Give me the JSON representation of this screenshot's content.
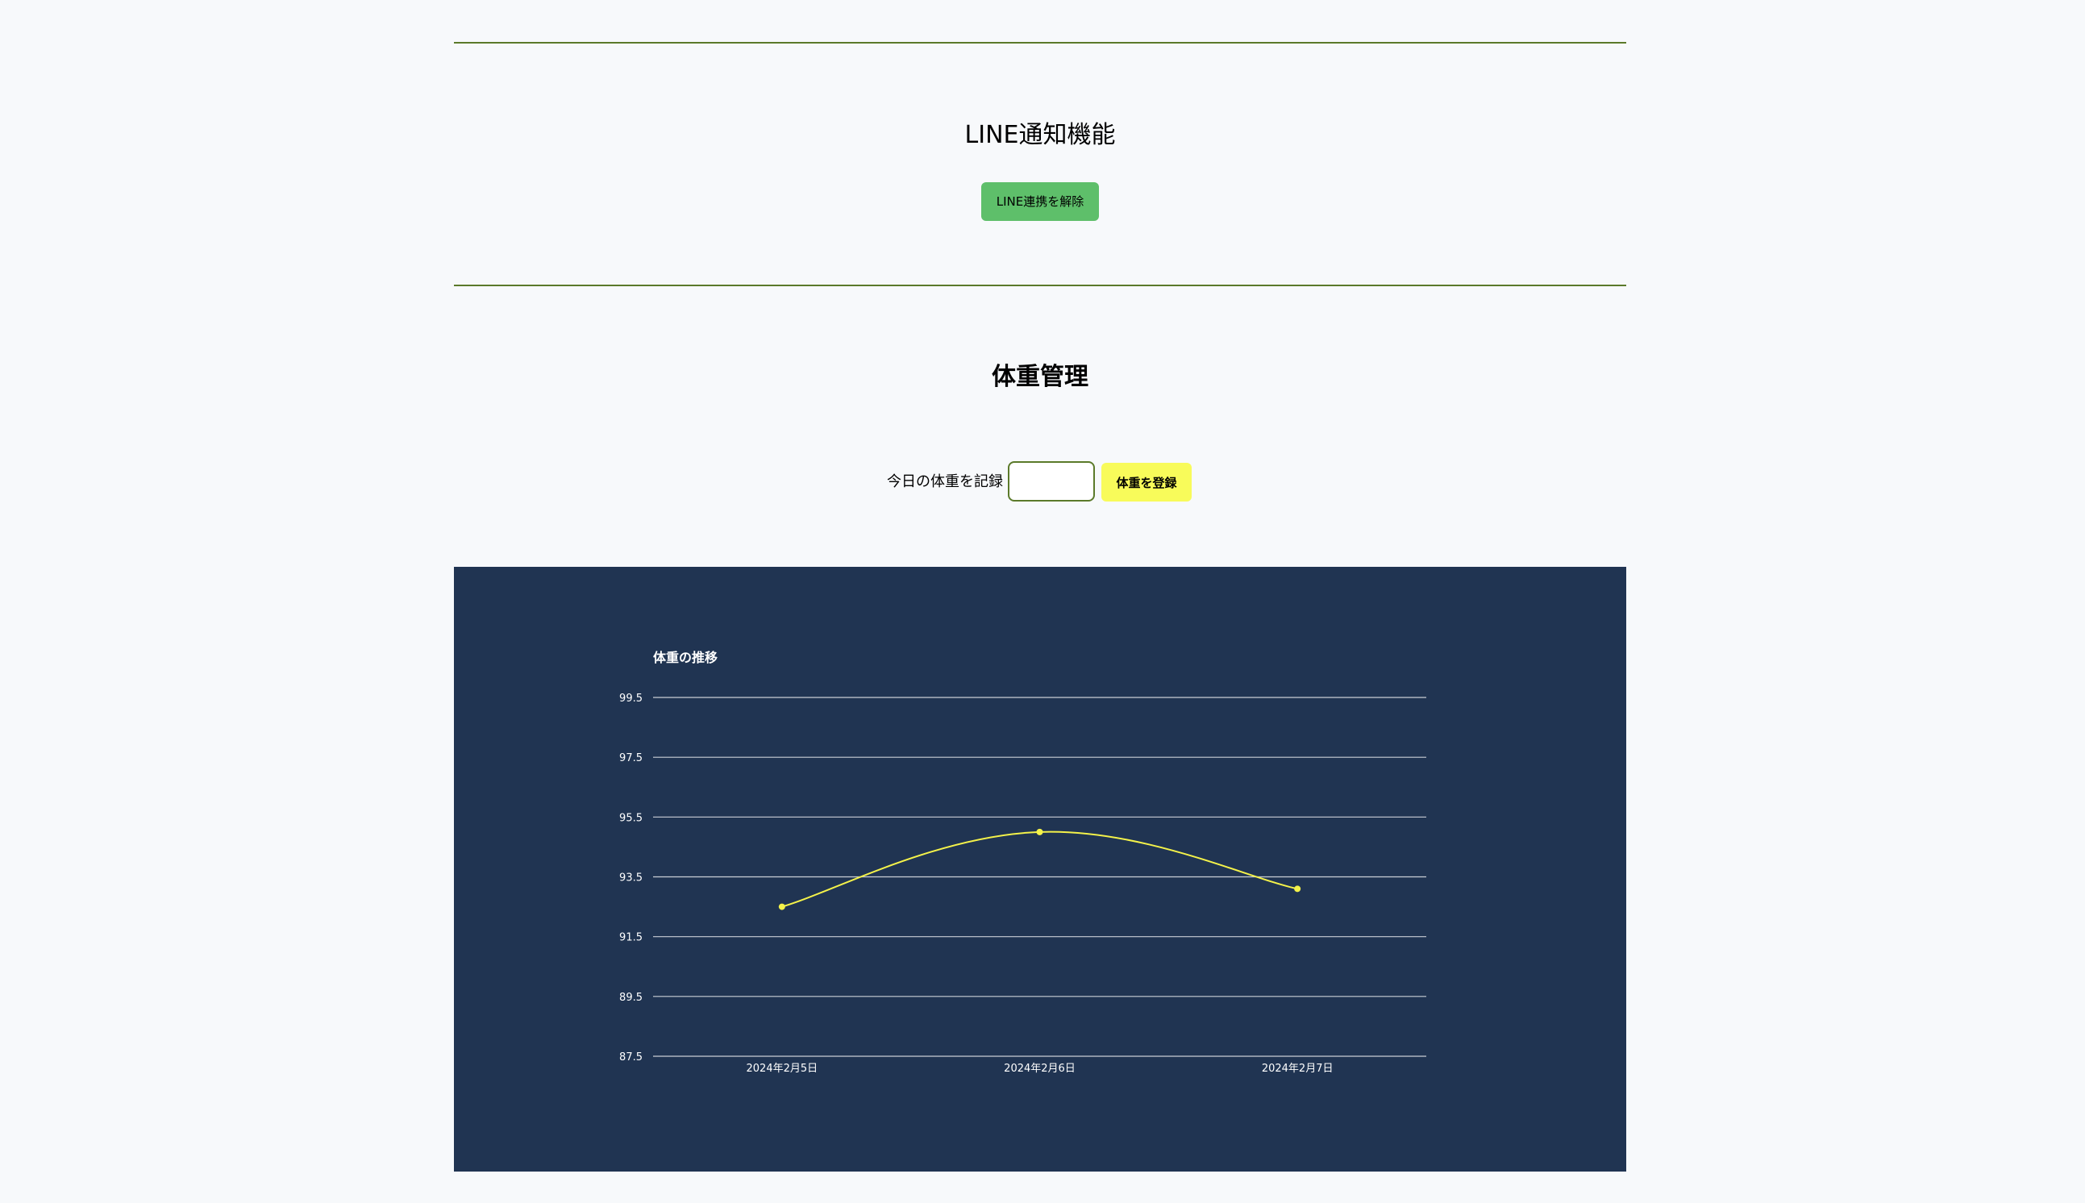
{
  "line_section": {
    "title": "LINE通知機能",
    "unlink_button": "LINE連携を解除"
  },
  "weight_section": {
    "title": "体重管理",
    "record_label": "今日の体重を記録",
    "input_value": "",
    "register_button": "体重を登録"
  },
  "colors": {
    "accent_green": "#5ebf6a",
    "rule_green": "#5b7a2a",
    "register_yellow": "#f8fb5a",
    "chart_bg": "#203452",
    "line_yellow": "#f4f24a"
  },
  "chart_data": {
    "type": "line",
    "title": "体重の推移",
    "categories": [
      "2024年2月5日",
      "2024年2月6日",
      "2024年2月7日"
    ],
    "series": [
      {
        "values": [
          92.5,
          95.0,
          93.1
        ]
      }
    ],
    "ylim": [
      87.5,
      99.5
    ],
    "yticks": [
      "99.5",
      "97.5",
      "95.5",
      "93.5",
      "91.5",
      "89.5",
      "87.5"
    ],
    "grid": true,
    "legend": "none",
    "smooth": true
  }
}
